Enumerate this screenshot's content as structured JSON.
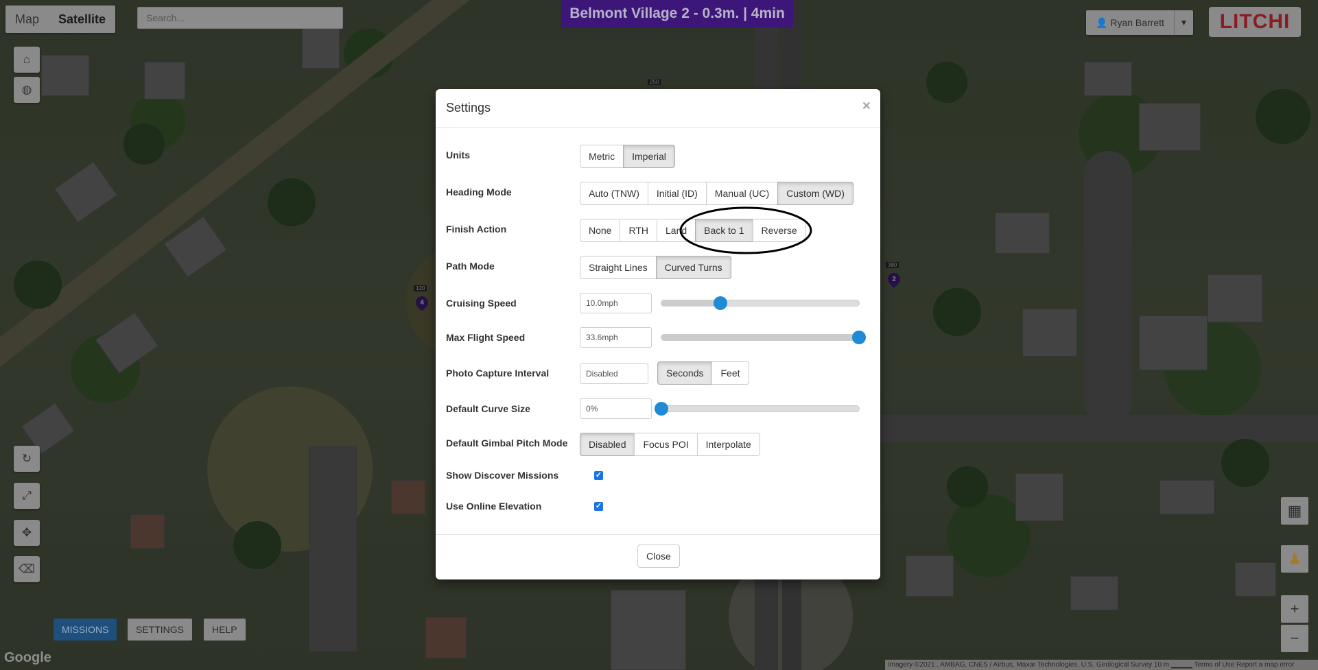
{
  "map": {
    "type_buttons": [
      "Map",
      "Satellite"
    ],
    "active_type": "Satellite",
    "search_placeholder": "Search...",
    "mission_title": "Belmont Village 2 - 0.3m. | 4min",
    "user_name": "Ryan Barrett",
    "logo_text": "LITCHI",
    "google_text": "Google",
    "attribution": "Imagery ©2021 , AMBAG, CNES / Airbus, Maxar Technologies, U.S. Geological Survey   10 m ▁▁▁▁   Terms of Use   Report a map error",
    "road_labels": [
      "250",
      "120",
      "380"
    ],
    "markers": [
      {
        "number": "4",
        "alt": "120"
      },
      {
        "number": "2",
        "alt": "380"
      }
    ]
  },
  "nav": {
    "missions": "MISSIONS",
    "settings": "SETTINGS",
    "help": "HELP"
  },
  "settings": {
    "title": "Settings",
    "close_x": "×",
    "close_button": "Close",
    "units": {
      "label": "Units",
      "options": [
        "Metric",
        "Imperial"
      ],
      "selected": "Imperial"
    },
    "heading_mode": {
      "label": "Heading Mode",
      "options": [
        "Auto (TNW)",
        "Initial (ID)",
        "Manual (UC)",
        "Custom (WD)"
      ],
      "selected": "Custom (WD)"
    },
    "finish_action": {
      "label": "Finish Action",
      "options": [
        "None",
        "RTH",
        "Land",
        "Back to 1",
        "Reverse"
      ],
      "selected": "Back to 1"
    },
    "path_mode": {
      "label": "Path Mode",
      "options": [
        "Straight Lines",
        "Curved Turns"
      ],
      "selected": "Curved Turns"
    },
    "cruising_speed": {
      "label": "Cruising Speed",
      "value": "10.0mph",
      "slider_fraction": 0.3
    },
    "max_flight_speed": {
      "label": "Max Flight Speed",
      "value": "33.6mph",
      "slider_fraction": 1.0
    },
    "photo_capture": {
      "label": "Photo Capture Interval",
      "value": "Disabled",
      "options": [
        "Seconds",
        "Feet"
      ],
      "selected": "Seconds"
    },
    "curve_size": {
      "label": "Default Curve Size",
      "value": "0%",
      "slider_fraction": 0.0
    },
    "gimbal_pitch": {
      "label": "Default Gimbal Pitch Mode",
      "options": [
        "Disabled",
        "Focus POI",
        "Interpolate"
      ],
      "selected": "Disabled"
    },
    "show_discover": {
      "label": "Show Discover Missions",
      "checked": true
    },
    "online_elevation": {
      "label": "Use Online Elevation",
      "checked": true
    }
  },
  "colors": {
    "mission_title_bg": "#3d167a",
    "slider_thumb": "#1f8ad6",
    "missions_bg": "#1e4f7d",
    "annotation": "#000000"
  }
}
